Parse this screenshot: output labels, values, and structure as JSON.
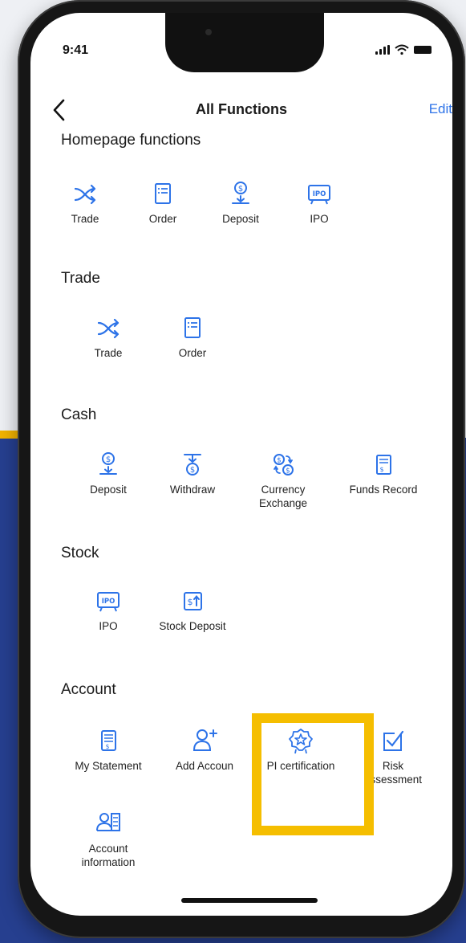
{
  "status_bar": {
    "time": "9:41"
  },
  "header": {
    "title": "All Functions",
    "edit_label": "Edit"
  },
  "accent_color": "#2d73e8",
  "highlight_color": "#f5be00",
  "sections": {
    "homepage": {
      "title": "Homepage  functions",
      "items": [
        {
          "label": "Trade",
          "icon": "trade-icon"
        },
        {
          "label": "Order",
          "icon": "order-icon"
        },
        {
          "label": "Deposit",
          "icon": "deposit-icon"
        },
        {
          "label": "IPO",
          "icon": "ipo-icon"
        }
      ]
    },
    "trade": {
      "title": "Trade",
      "items": [
        {
          "label": "Trade",
          "icon": "trade-icon"
        },
        {
          "label": "Order",
          "icon": "order-icon"
        }
      ]
    },
    "cash": {
      "title": "Cash",
      "items": [
        {
          "label": "Deposit",
          "icon": "deposit-icon"
        },
        {
          "label": "Withdraw",
          "icon": "withdraw-icon"
        },
        {
          "label": "Currency Exchange",
          "icon": "currency-exchange-icon"
        },
        {
          "label": "Funds Record",
          "icon": "funds-record-icon"
        }
      ]
    },
    "stock": {
      "title": "Stock",
      "items": [
        {
          "label": "IPO",
          "icon": "ipo-icon"
        },
        {
          "label": "Stock Deposit",
          "icon": "stock-deposit-icon"
        }
      ]
    },
    "account": {
      "title": "Account",
      "items": [
        {
          "label": "My Statement",
          "icon": "statement-icon"
        },
        {
          "label": "Add Accoun",
          "icon": "add-account-icon"
        },
        {
          "label": "PI certification",
          "icon": "pi-certification-icon"
        },
        {
          "label": "Risk assessment",
          "icon": "risk-assessment-icon"
        },
        {
          "label": "Account information",
          "icon": "account-information-icon"
        }
      ]
    }
  }
}
